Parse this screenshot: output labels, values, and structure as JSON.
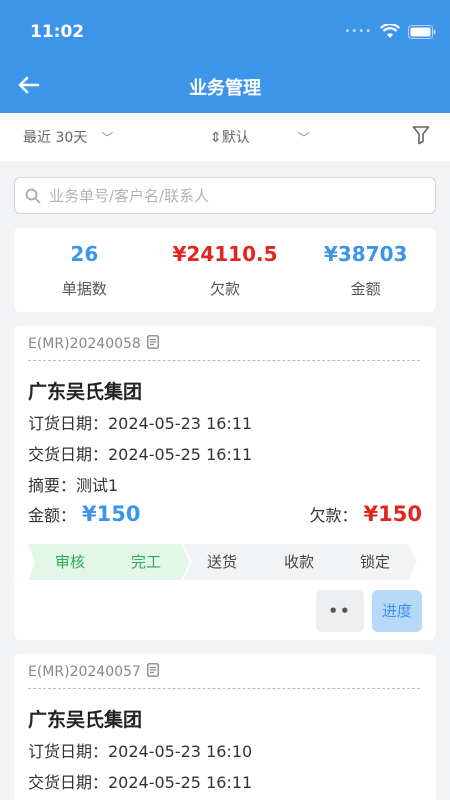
{
  "status_bar": {
    "time": "11:02",
    "wifi_icon": "wifi-icon",
    "battery_icon": "battery-icon"
  },
  "header": {
    "title": "业务管理",
    "back_icon": "arrow-left-icon"
  },
  "filters": {
    "date_range": "最近 30天",
    "sort": "⇕默认",
    "filter_icon": "funnel-icon"
  },
  "search": {
    "placeholder": "业务单号/客户名/联系人"
  },
  "summary": [
    {
      "value": "26",
      "label": "单据数",
      "color": "#3d95ea"
    },
    {
      "value": "¥24110.5",
      "label": "欠款",
      "color": "#e0261d"
    },
    {
      "value": "¥38703",
      "label": "金额",
      "color": "#3d95ea"
    }
  ],
  "orders": [
    {
      "order_no": "E(MR)20240058",
      "customer": "广东吴氏集团",
      "order_date": "订货日期：2024-05-23 16:11",
      "delivery_date": "交货日期：2024-05-25 16:11",
      "summary": "摘要：测试1",
      "amount_label": "金额：",
      "amount": "¥150",
      "debt_label": "欠款：",
      "debt": "¥150",
      "steps": [
        {
          "label": "审核",
          "done": true
        },
        {
          "label": "完工",
          "done": true
        },
        {
          "label": "送货",
          "done": false
        },
        {
          "label": "收款",
          "done": false
        },
        {
          "label": "锁定",
          "done": false
        }
      ],
      "more_label": "••",
      "progress_label": "进度"
    },
    {
      "order_no": "E(MR)20240057",
      "customer": "广东吴氏集团",
      "order_date": "订货日期：2024-05-23 16:10",
      "delivery_date": "交货日期：2024-05-25 16:11"
    }
  ],
  "colors": {
    "primary": "#3d95ea",
    "danger": "#e0261d",
    "step_done_bg": "#e3f7e8",
    "step_done_text": "#2faa5a"
  }
}
